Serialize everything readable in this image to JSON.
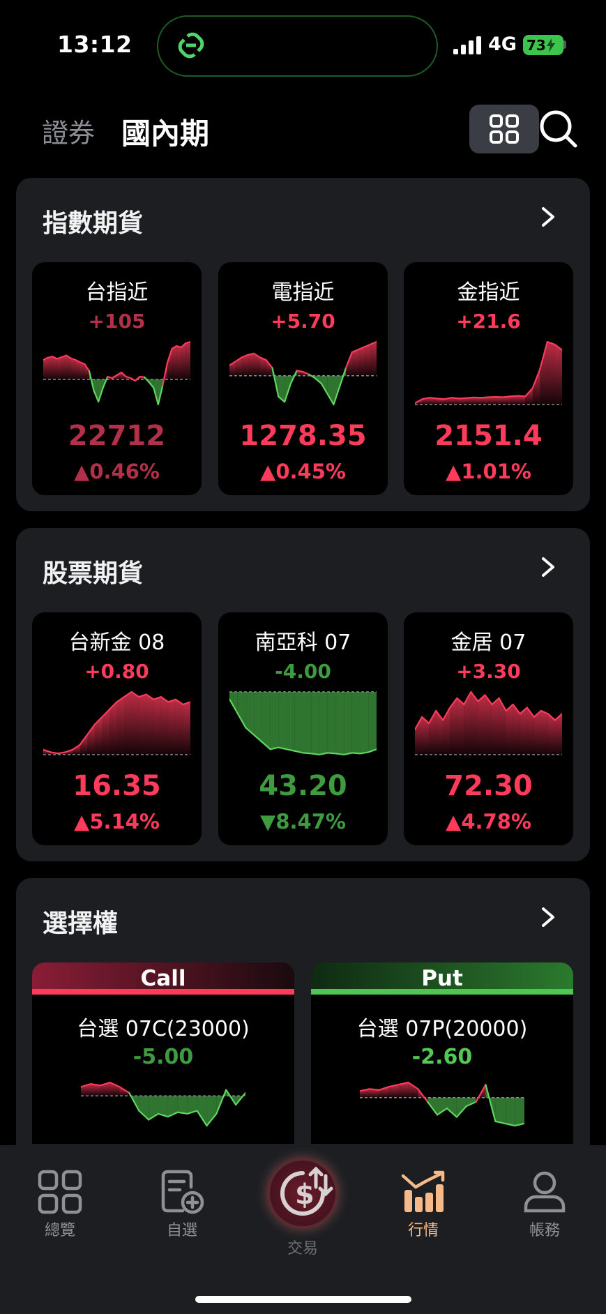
{
  "status": {
    "time": "13:12",
    "network": "4G",
    "battery": "73"
  },
  "header": {
    "tab_securities": "證券",
    "tab_domestic_futures": "國內期"
  },
  "colors": {
    "up": "#ff3b5c",
    "down": "#3f9b3f",
    "panel": "#1c1e22",
    "active_nav": "#f5b98a"
  },
  "sections": {
    "index_futures": {
      "title": "指數期貨",
      "cards": [
        {
          "name": "台指近",
          "change": "+105",
          "price": "22712",
          "pct": "▲0.46%",
          "direction": "up",
          "spark": [
            0.7,
            0.78,
            0.82,
            0.74,
            0.8,
            0.86,
            0.76,
            0.7,
            0.62,
            0.55,
            0.3,
            -0.4,
            -0.8,
            -0.3,
            0.1,
            0.05,
            0.15,
            0.25,
            0.1,
            0.05,
            -0.05,
            0.1,
            0.08,
            -0.1,
            -0.3,
            -0.9,
            -0.2,
            0.6,
            1.1,
            1.2,
            1.15,
            1.3,
            1.35
          ]
        },
        {
          "name": "電指近",
          "change": "+5.70",
          "price": "1278.35",
          "pct": "▲0.45%",
          "direction": "up",
          "spark": [
            0.4,
            0.55,
            0.7,
            0.8,
            0.85,
            0.7,
            0.6,
            0.3,
            -0.8,
            -1.0,
            -0.3,
            0.2,
            0.15,
            0.05,
            -0.1,
            -0.3,
            -0.7,
            -1.1,
            -0.4,
            0.3,
            0.9,
            1.0,
            1.1,
            1.2,
            1.3
          ]
        },
        {
          "name": "金指近",
          "change": "+21.6",
          "price": "2151.4",
          "pct": "▲1.01%",
          "direction": "up",
          "spark": [
            0.05,
            0.2,
            0.25,
            0.22,
            0.2,
            0.25,
            0.22,
            0.24,
            0.26,
            0.25,
            0.27,
            0.28,
            0.27,
            0.3,
            0.32,
            0.3,
            0.6,
            1.3,
            2.3,
            2.2,
            2.0
          ]
        }
      ]
    },
    "stock_futures": {
      "title": "股票期貨",
      "cards": [
        {
          "name": "台新金 08",
          "change": "+0.80",
          "price": "16.35",
          "pct": "▲5.14%",
          "direction": "up",
          "spark": [
            0.2,
            0.1,
            0.05,
            0.1,
            0.2,
            0.4,
            0.8,
            1.2,
            1.5,
            1.8,
            2.1,
            2.3,
            2.5,
            2.3,
            2.4,
            2.2,
            2.3,
            2.1,
            2.2,
            2.0,
            2.1
          ]
        },
        {
          "name": "南亞科 07",
          "change": "-4.00",
          "price": "43.20",
          "pct": "▼8.47%",
          "direction": "down",
          "spark": [
            -0.2,
            -0.6,
            -1.0,
            -1.2,
            -1.4,
            -1.6,
            -1.55,
            -1.6,
            -1.65,
            -1.7,
            -1.72,
            -1.75,
            -1.7,
            -1.72,
            -1.75,
            -1.7,
            -1.72,
            -1.68,
            -1.6
          ]
        },
        {
          "name": "金居 07",
          "change": "+3.30",
          "price": "72.30",
          "pct": "▲4.78%",
          "direction": "up",
          "spark": [
            0.8,
            1.2,
            1.0,
            1.4,
            1.1,
            1.5,
            1.8,
            1.6,
            2.0,
            1.7,
            1.9,
            1.6,
            1.8,
            1.4,
            1.6,
            1.3,
            1.5,
            1.2,
            1.4,
            1.3,
            1.1,
            1.3
          ]
        }
      ]
    },
    "options": {
      "title": "選擇權",
      "call": {
        "header": "Call",
        "name": "台選 07C(23000)",
        "change": "-5.00",
        "spark": [
          0.3,
          0.4,
          0.35,
          0.45,
          0.3,
          0.1,
          -0.5,
          -0.8,
          -0.6,
          -0.7,
          -0.55,
          -0.6,
          -0.5,
          -1.0,
          -0.6,
          0.2,
          -0.3,
          0.1
        ]
      },
      "put": {
        "header": "Put",
        "name": "台選 07P(20000)",
        "change": "-2.60",
        "spark": [
          0.3,
          0.4,
          0.35,
          0.5,
          0.6,
          0.7,
          0.4,
          -0.2,
          -0.8,
          -0.5,
          -0.9,
          -0.4,
          -0.2,
          0.6,
          -1.1,
          -1.2,
          -1.3,
          -1.2
        ]
      }
    }
  },
  "nav": {
    "overview": "總覽",
    "watchlist": "自選",
    "trade": "交易",
    "quotes": "行情",
    "account": "帳務"
  }
}
